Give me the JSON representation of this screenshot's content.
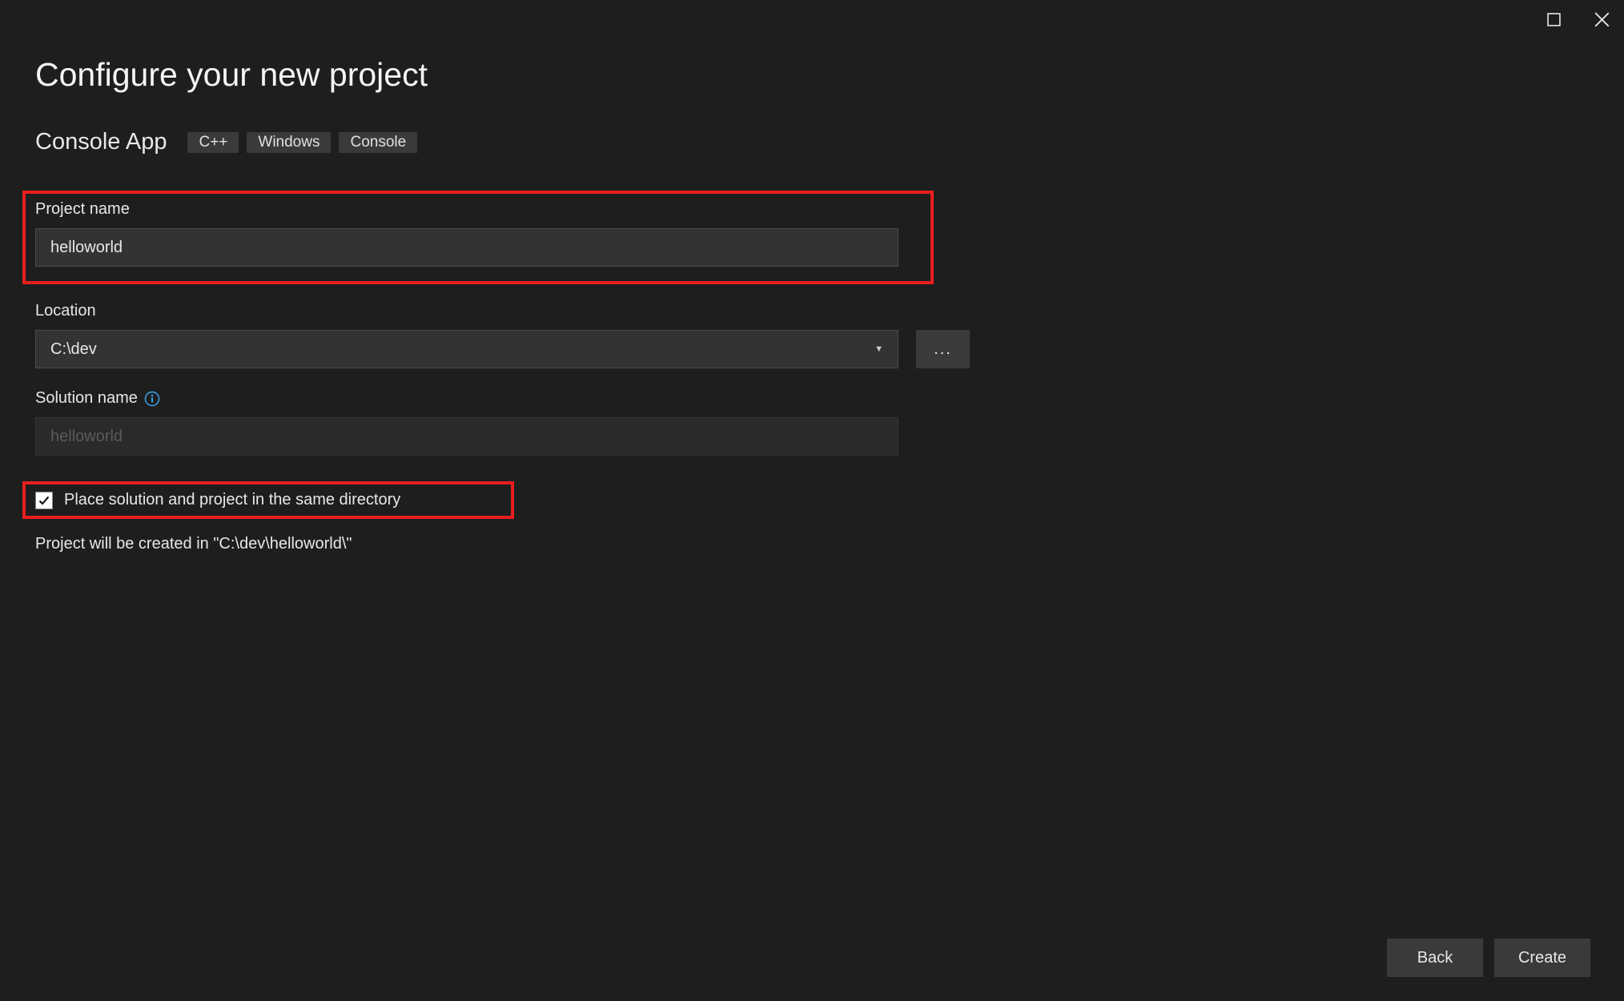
{
  "titleBar": {
    "maximize": "maximize",
    "close": "close"
  },
  "header": {
    "title": "Configure your new project",
    "subtitle": "Console App",
    "tags": [
      "C++",
      "Windows",
      "Console"
    ]
  },
  "form": {
    "projectName": {
      "label": "Project name",
      "value": "helloworld"
    },
    "location": {
      "label": "Location",
      "value": "C:\\dev",
      "browseLabel": "..."
    },
    "solutionName": {
      "label": "Solution name",
      "placeholder": "helloworld"
    },
    "sameDirectory": {
      "checked": true,
      "label": "Place solution and project in the same directory"
    },
    "infoText": "Project will be created in \"C:\\dev\\helloworld\\\""
  },
  "footer": {
    "back": "Back",
    "create": "Create"
  }
}
